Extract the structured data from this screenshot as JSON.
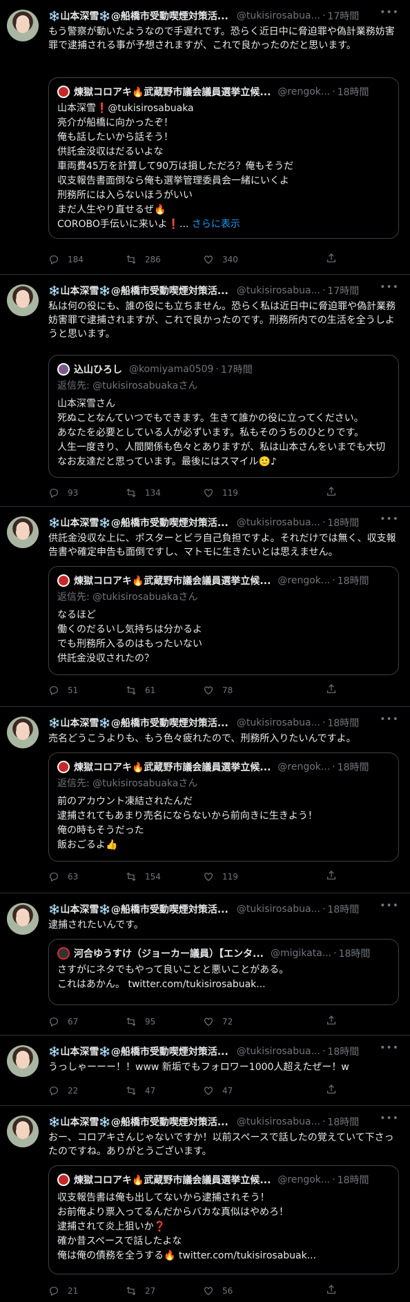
{
  "tweets": [
    {
      "name": "❄️山本深雪❄️@船橋市受動喫煙対策活...",
      "handle": "@tukisirosabua...",
      "time": "17時間",
      "text": "もう警察が動いたようなので手遅れです。恐らく近日中に脅迫罪や偽計業務妨害罪で逮捕される事が予想されますが、これで良かったのだと思います。",
      "quote": {
        "name": "煉獄コロアキ🔥武蔵野市議会議員選挙立候...",
        "handle": "@rengok...",
        "time": "18時間",
        "reply_to": "",
        "text": "山本深雪❗@tukisirosabuaka\n亮介が船橋に向かったぞ！\n俺も話したいから話そう！\n供託金没収はだるいよな\n車両費45万を計算して90万は損しただろ？俺もそうだ\n収支報告書面倒なら俺も選挙管理委員会一緒にいくよ\n刑務所には入らないほうがいい\nまだ人生やり直せるぜ🔥\nCOROBO手伝いに来いよ❗... ",
        "show_more": "さらに表示"
      },
      "replies": "184",
      "retweets": "286",
      "likes": "340"
    },
    {
      "name": "❄️山本深雪❄️@船橋市受動喫煙対策活...",
      "handle": "@tukisirosabua...",
      "time": "17時間",
      "text": "私は何の役にも、誰の役にも立ちません。恐らく私は近日中に脅迫罪や偽計業務妨害罪で逮捕されますが、これで良かったのです。刑務所内での生活を全うしようと思います。",
      "quote": {
        "name": "込山ひろし",
        "handle": "@komiyama0509",
        "time": "17時間",
        "reply_to": "返信先: @tukisirosabuakaさん",
        "text": "山本深雪さん\n死ぬことなんていつでもできます。生きて誰かの役に立ってください。\nあなたを必要としている人が必ずいます。私もそのうちのひとりです。\n人生一度きり、人間関係も色々とありますが、私は山本さんをいまでも大切なお友達だと思っています。最後にはスマイル🙂♪",
        "show_more": ""
      },
      "replies": "93",
      "retweets": "134",
      "likes": "119"
    },
    {
      "name": "❄️山本深雪❄️@船橋市受動喫煙対策活...",
      "handle": "@tukisirosabua...",
      "time": "18時間",
      "text": "供託金没収な上に、ポスターとビラ自己負担ですよ。それだけでは無く、収支報告書や確定申告も面倒ですし、マトモに生きたいとは思えません。",
      "quote": {
        "name": "煉獄コロアキ🔥武蔵野市議会議員選挙立候...",
        "handle": "@rengok...",
        "time": "18時間",
        "reply_to": "返信先: @tukisirosabuakaさん",
        "text": "なるほど\n働くのだるいし気持ちは分かるよ\nでも刑務所入るのはもったいない\n供託金没収されたの？",
        "show_more": ""
      },
      "replies": "51",
      "retweets": "61",
      "likes": "78"
    },
    {
      "name": "❄️山本深雪❄️@船橋市受動喫煙対策活...",
      "handle": "@tukisirosabua...",
      "time": "18時間",
      "text": "売名どうこうよりも、もう色々疲れたので、刑務所入りたいんですよ。",
      "quote": {
        "name": "煉獄コロアキ🔥武蔵野市議会議員選挙立候...",
        "handle": "@rengok...",
        "time": "18時間",
        "reply_to": "返信先: @tukisirosabuakaさん",
        "text": "前のアカウント凍結されたんだ\n逮捕されてもあまり売名にならないから前向きに生きよう！\n俺の時もそうだった\n飯おごるよ👍",
        "show_more": ""
      },
      "replies": "63",
      "retweets": "154",
      "likes": "119"
    },
    {
      "name": "❄️山本深雪❄️@船橋市受動喫煙対策活...",
      "handle": "@tukisirosabua...",
      "time": "18時間",
      "text": "逮捕されたいんです。",
      "quote": {
        "name": "河合ゆうすけ（ジョーカー議員）【エンタ...",
        "handle": "@migikata...",
        "time": "18時間",
        "reply_to": "",
        "text": "さすがにネタでもやって良いことと悪いことがある。\nこれはあかん。 twitter.com/tukisirosabuak...",
        "show_more": ""
      },
      "replies": "67",
      "retweets": "95",
      "likes": "72"
    },
    {
      "name": "❄️山本深雪❄️@船橋市受動喫煙対策活...",
      "handle": "@tukisirosabua...",
      "time": "18時間",
      "text": "うっしゃーーー！！www 新垢でもフォロワー1000人超えたぜー！w",
      "quote": null,
      "replies": "22",
      "retweets": "47",
      "likes": "47"
    },
    {
      "name": "❄️山本深雪❄️@船橋市受動喫煙対策活...",
      "handle": "@tukisirosabua...",
      "time": "18時間",
      "text": "おー、コロアキさんじゃないですか！以前スペースで話したの覚えていて下さったのですね。ありがとうございます。",
      "quote": {
        "name": "煉獄コロアキ🔥武蔵野市議会議員選挙立候...",
        "handle": "@rengok...",
        "time": "18時間",
        "reply_to": "",
        "text": "収支報告書は俺も出してないから逮捕されそう！\nお前俺より票入ってるんだからバカな真似はやめろ！\n逮捕されて炎上狙いか❓\n確か昔スペースで話したよな\n俺は俺の債務を全うする🔥 twitter.com/tukisirosabuak...",
        "show_more": ""
      },
      "replies": "21",
      "retweets": "27",
      "likes": "56"
    }
  ]
}
